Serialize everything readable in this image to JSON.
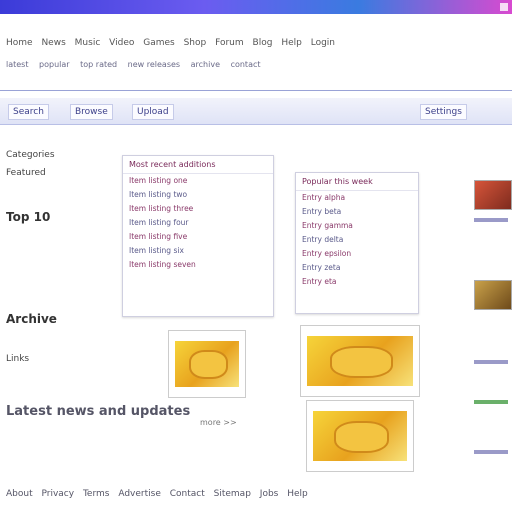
{
  "window": {
    "title": ""
  },
  "menu": {
    "items": [
      "Home",
      "News",
      "Music",
      "Video",
      "Games",
      "Shop",
      "Forum",
      "Blog",
      "Help",
      "Login"
    ]
  },
  "subnav": {
    "items": [
      "latest",
      "popular",
      "top rated",
      "new releases",
      "archive",
      "contact"
    ]
  },
  "toolbar": {
    "buttons": [
      "Search",
      "Browse",
      "Upload",
      "Settings"
    ]
  },
  "left_panel": {
    "items": [
      {
        "label": "Categories",
        "strong": false
      },
      {
        "label": "Featured",
        "strong": false
      },
      {
        "label": "Top 10",
        "strong": true
      },
      {
        "label": "Archive",
        "strong": true
      },
      {
        "label": "Links",
        "strong": false
      }
    ]
  },
  "main": {
    "card1": {
      "header": "Most recent additions",
      "rows": [
        "Item listing one",
        "Item listing two",
        "Item listing three",
        "Item listing four",
        "Item listing five",
        "Item listing six",
        "Item listing seven"
      ]
    },
    "card2": {
      "header": "Popular this week",
      "rows": [
        "Entry alpha",
        "Entry beta",
        "Entry gamma",
        "Entry delta",
        "Entry epsilon",
        "Entry zeta",
        "Entry eta"
      ]
    },
    "caption": "Latest news and updates",
    "caption_small": "more >>"
  },
  "footer": {
    "links": [
      "About",
      "Privacy",
      "Terms",
      "Advertise",
      "Contact",
      "Sitemap",
      "Jobs",
      "Help"
    ]
  },
  "colors": {
    "accent": "#3b3bd8",
    "link": "#8a3a6a"
  }
}
